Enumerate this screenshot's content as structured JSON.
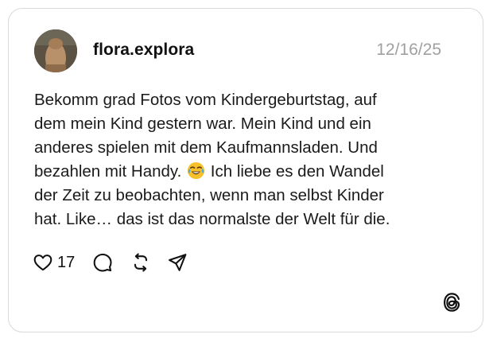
{
  "post": {
    "username": "flora.explora",
    "timestamp": "12/16/25",
    "lines": [
      "Bekomm grad Fotos vom Kindergeburtstag, auf",
      "dem mein Kind gestern war. Mein Kind und ein",
      "anderes spielen mit dem Kaufmannsladen. Und",
      "bezahlen mit Handy.",
      "Ich liebe es den Wandel",
      "der Zeit zu beobachten, wenn man selbst Kinder",
      "hat. Like… das ist das normalste der Welt für die."
    ],
    "emoji": "face-with-tears-of-joy",
    "likes": "17"
  },
  "icons": {
    "like": "heart-icon",
    "comment": "comment-icon",
    "repost": "repost-icon",
    "share": "send-icon",
    "brand": "threads-logo"
  },
  "colors": {
    "border": "#d9d9d9",
    "timestamp": "#a0a0a0",
    "text": "#1a1a1a"
  }
}
